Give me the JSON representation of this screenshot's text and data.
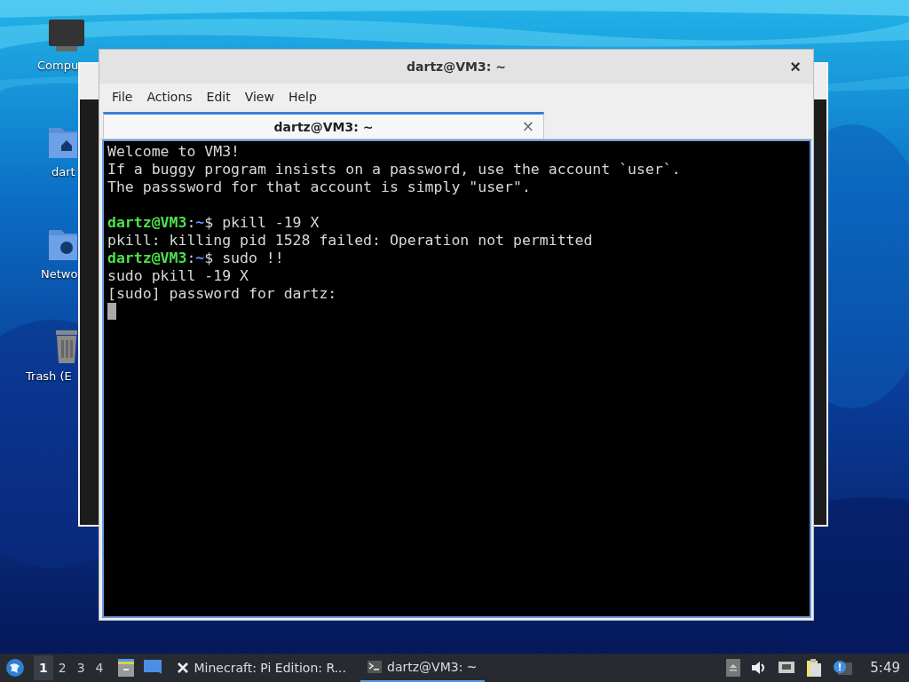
{
  "desktop_icons": [
    {
      "kind": "computer",
      "label": "Compu"
    },
    {
      "kind": "home",
      "label": "dart"
    },
    {
      "kind": "network",
      "label": "Netwo"
    },
    {
      "kind": "trash",
      "label": "Trash (E"
    }
  ],
  "window": {
    "title": "dartz@VM3: ~",
    "close": "×"
  },
  "menu": [
    "File",
    "Actions",
    "Edit",
    "View",
    "Help"
  ],
  "tabs": [
    {
      "label": "dartz@VM3: ~",
      "close": "×",
      "selected": true
    }
  ],
  "terminal": [
    {
      "kind": "text",
      "text": "Welcome to VM3!"
    },
    {
      "kind": "text",
      "text": "If a buggy program insists on a password, use the account `user`."
    },
    {
      "kind": "text",
      "text": "The passsword for that account is simply \"user\"."
    },
    {
      "kind": "blank"
    },
    {
      "kind": "prompt",
      "user": "dartz@VM3",
      "sep": ":",
      "path": "~",
      "command": "$ pkill -19 X"
    },
    {
      "kind": "text",
      "text": "pkill: killing pid 1528 failed: Operation not permitted"
    },
    {
      "kind": "prompt",
      "user": "dartz@VM3",
      "sep": ":",
      "path": "~",
      "command": "$ sudo !!"
    },
    {
      "kind": "text",
      "text": "sudo pkill -19 X"
    },
    {
      "kind": "text",
      "text": "[sudo] password for dartz:"
    },
    {
      "kind": "cursor"
    }
  ],
  "taskbar": {
    "workspaces": [
      {
        "label": "1",
        "selected": true
      },
      {
        "label": "2",
        "selected": false
      },
      {
        "label": "3",
        "selected": false
      },
      {
        "label": "4",
        "selected": false
      }
    ],
    "tasks": [
      {
        "kind": "x",
        "label": "Minecraft: Pi Edition: R...",
        "selected": false
      },
      {
        "kind": "terminal",
        "label": "dartz@VM3: ~",
        "selected": true
      }
    ],
    "clock": "5:49"
  }
}
